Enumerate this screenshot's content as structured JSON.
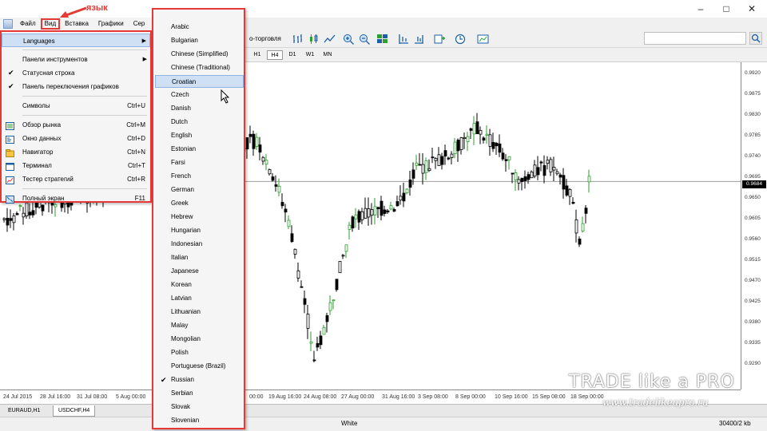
{
  "window": {
    "controls": [
      "–",
      "□",
      "✕"
    ]
  },
  "annotation": {
    "text": "язык",
    "color": "#e53935"
  },
  "menubar": {
    "items": [
      "Файл",
      "Вид",
      "Вставка",
      "Графики",
      "Сер"
    ],
    "highlighted": "Вид"
  },
  "toolbar": {
    "label": "о-торговля",
    "icons": [
      "bar-chart-icon",
      "candles-icon",
      "line-chart-icon",
      "zoom-in-icon",
      "zoom-out-icon",
      "tile-windows-icon",
      "chart-shift-icon",
      "autoscroll-icon",
      "indicators-icon",
      "periods-icon",
      "templates-icon"
    ]
  },
  "timeframes": {
    "items": [
      "H1",
      "H4",
      "D1",
      "W1",
      "MN"
    ],
    "active": "H4"
  },
  "view_menu": {
    "items": [
      {
        "label": "Languages",
        "shortcut": "",
        "submenu": true,
        "icon": "",
        "checked": false,
        "selected": true
      },
      {
        "separator": true
      },
      {
        "label": "Панели инструментов",
        "shortcut": "",
        "submenu": true,
        "icon": "",
        "checked": false
      },
      {
        "label": "Статусная строка",
        "shortcut": "",
        "submenu": false,
        "icon": "",
        "checked": true
      },
      {
        "label": "Панель переключения графиков",
        "shortcut": "",
        "submenu": false,
        "icon": "",
        "checked": true
      },
      {
        "separator": true
      },
      {
        "label": "Символы",
        "shortcut": "Ctrl+U",
        "submenu": false,
        "icon": "",
        "checked": false
      },
      {
        "separator": true
      },
      {
        "label": "Обзор рынка",
        "shortcut": "Ctrl+M",
        "submenu": false,
        "icon": "market-watch-icon",
        "checked": false
      },
      {
        "label": "Окно данных",
        "shortcut": "Ctrl+D",
        "submenu": false,
        "icon": "data-window-icon",
        "checked": false
      },
      {
        "label": "Навигатор",
        "shortcut": "Ctrl+N",
        "submenu": false,
        "icon": "navigator-icon",
        "checked": false
      },
      {
        "label": "Терминал",
        "shortcut": "Ctrl+T",
        "submenu": false,
        "icon": "terminal-icon",
        "checked": false
      },
      {
        "label": "Тестер стратегий",
        "shortcut": "Ctrl+R",
        "submenu": false,
        "icon": "strategy-tester-icon",
        "checked": false
      },
      {
        "separator": true
      },
      {
        "label": "Полный экран",
        "shortcut": "F11",
        "submenu": false,
        "icon": "fullscreen-icon",
        "checked": false
      }
    ]
  },
  "languages": {
    "items": [
      "Arabic",
      "Bulgarian",
      "Chinese (Simplified)",
      "Chinese (Traditional)",
      "Croatian",
      "Czech",
      "Danish",
      "Dutch",
      "English",
      "Estonian",
      "Farsi",
      "French",
      "German",
      "Greek",
      "Hebrew",
      "Hungarian",
      "Indonesian",
      "Italian",
      "Japanese",
      "Korean",
      "Latvian",
      "Lithuanian",
      "Malay",
      "Mongolian",
      "Polish",
      "Portuguese (Brazil)",
      "Russian",
      "Serbian",
      "Slovak",
      "Slovenian"
    ],
    "hovered": "Croatian",
    "checked": "Russian"
  },
  "chart": {
    "price_ticks": [
      "0.9920",
      "0.9875",
      "0.9830",
      "0.9785",
      "0.9740",
      "0.9695",
      "0.9650",
      "0.9605",
      "0.9560",
      "0.9515",
      "0.9470",
      "0.9425",
      "0.9380",
      "0.9335",
      "0.9290"
    ],
    "current_price": "0.9684",
    "time_ticks": [
      "24 Jul 2015",
      "28 Jul 16:00",
      "31 Jul 08:00",
      "5 Aug 00:00",
      "00:00",
      "19 Aug 16:00",
      "24 Aug 08:00",
      "27 Aug 00:00",
      "31 Aug 16:00",
      "3 Sep 08:00",
      "8 Sep 00:00",
      "10 Sep 16:00",
      "15 Sep 08:00",
      "18 Sep 00:00"
    ],
    "bull_color": "#2e9e2e",
    "bear_color": "#000000"
  },
  "tabs": {
    "items": [
      "EURAUD,H1",
      "USDCHF,H4"
    ],
    "active": "USDCHF,H4"
  },
  "statusbar": {
    "profile": "White",
    "traffic": "30400/2 kb"
  },
  "watermark": {
    "title": "TRADE like a PRO",
    "url": "www.tradelikeapro.ru"
  }
}
